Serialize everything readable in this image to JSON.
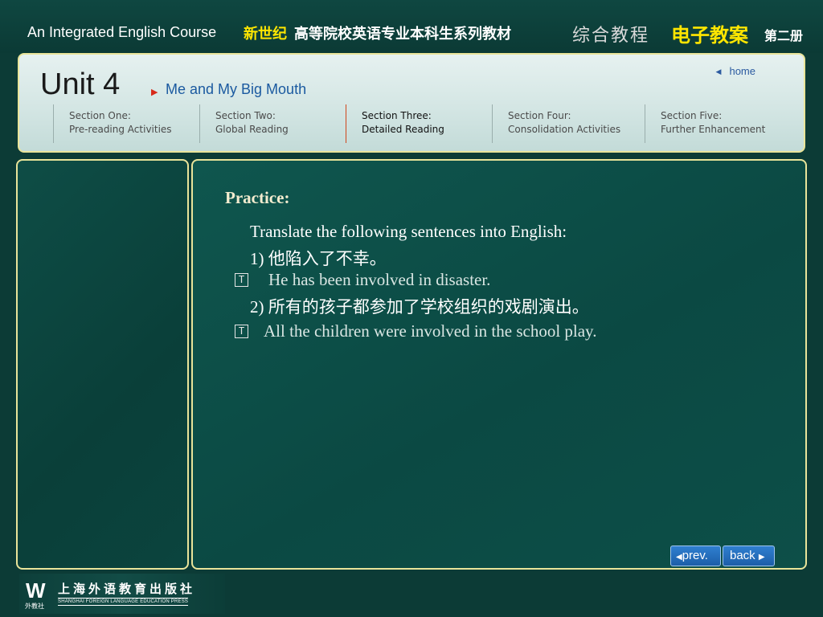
{
  "banner": {
    "course_en": "An Integrated English Course",
    "series_highlight": "新世纪",
    "series_rest": "高等院校英语专业本科生系列教材",
    "textbook": "综合教程",
    "e_lesson": "电子教案",
    "volume": "第二册"
  },
  "header": {
    "unit": "Unit 4",
    "subtitle": "Me and My Big Mouth",
    "home": "home"
  },
  "sections": [
    {
      "line1": "Section One:",
      "line2": "Pre-reading Activities",
      "active": false
    },
    {
      "line1": "Section Two:",
      "line2": "Global Reading",
      "active": false
    },
    {
      "line1": "Section Three:",
      "line2": "Detailed Reading",
      "active": true
    },
    {
      "line1": "Section Four:",
      "line2": "Consolidation Activities",
      "active": false
    },
    {
      "line1": "Section Five:",
      "line2": "Further Enhancement",
      "active": false
    }
  ],
  "content": {
    "title": "Practice:",
    "instruction": "Translate the following sentences into English:",
    "items": [
      {
        "question": "1) 他陷入了不幸。",
        "answer": "He has been involved in disaster.",
        "toggle_icon": "T"
      },
      {
        "question": "2) 所有的孩子都参加了学校组织的戏剧演出。",
        "answer": "All the children were involved in the school play.",
        "toggle_icon": "T"
      }
    ]
  },
  "nav": {
    "prev": "prev.",
    "back": "back"
  },
  "publisher": {
    "logo": "W",
    "logo_sub": "外教社",
    "name_cn": "上海外语教育出版社",
    "name_en": "SHANGHAI FOREIGN LANGUAGE EDUCATION PRESS"
  },
  "colors": {
    "background": "#0c3b36",
    "panel_border": "#e9e49a",
    "accent_yellow": "#ffe600",
    "button_blue": "#1c5ea8"
  }
}
